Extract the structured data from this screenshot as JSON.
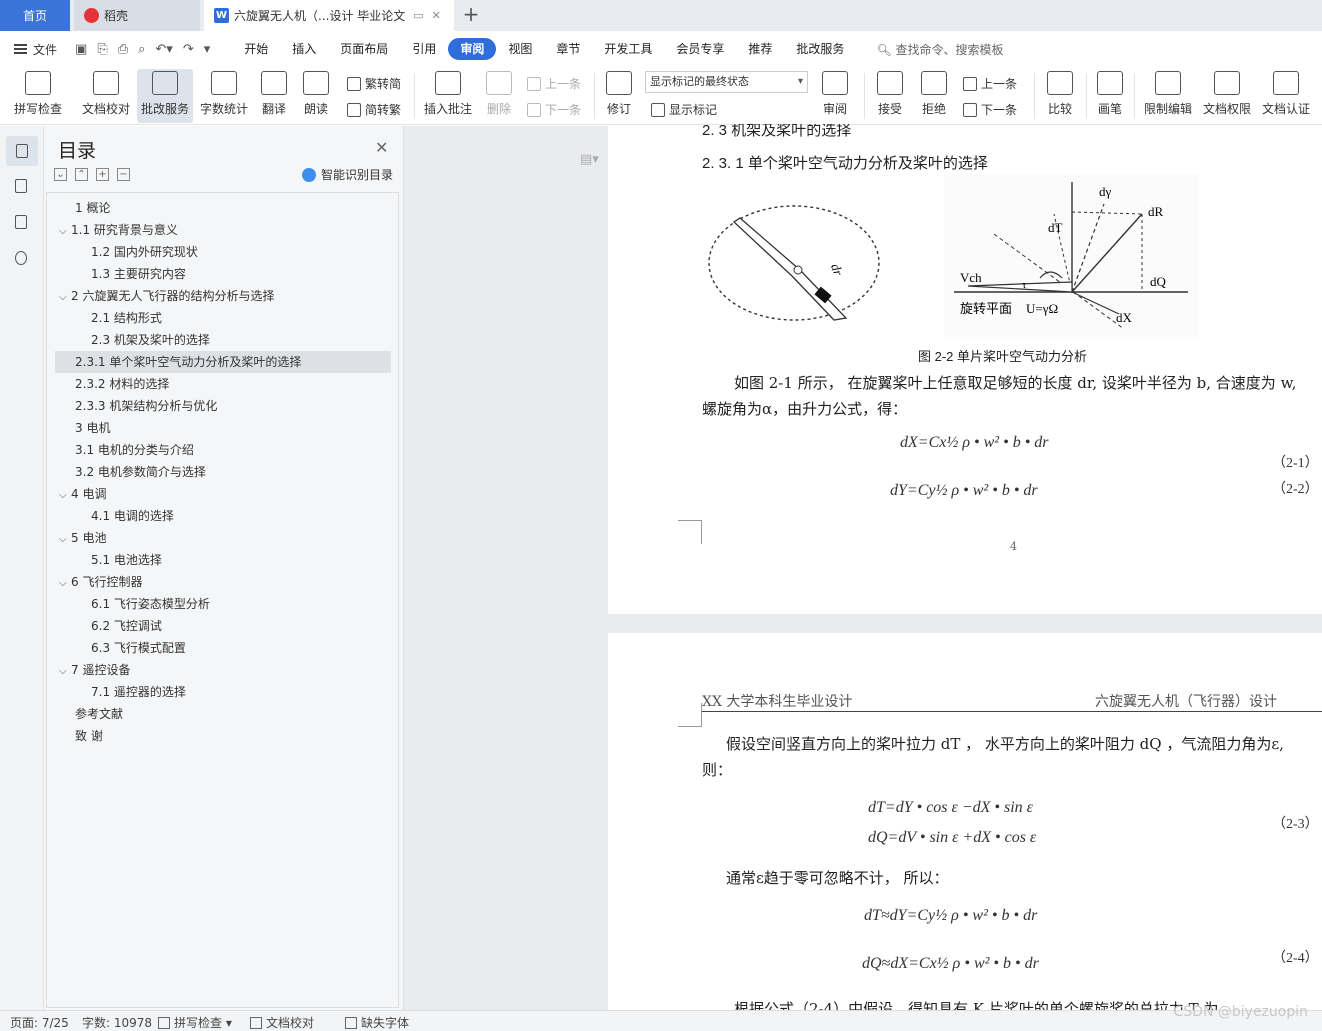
{
  "tabs": {
    "home": "首页",
    "daoke": "稻壳",
    "doc": "六旋翼无人机（...设计 毕业论文"
  },
  "menu": {
    "file": "文件",
    "tabs": [
      "开始",
      "插入",
      "页面布局",
      "引用",
      "审阅",
      "视图",
      "章节",
      "开发工具",
      "会员专享",
      "推荐",
      "批改服务"
    ],
    "active_tab": "审阅",
    "search": "查找命令、搜索模板"
  },
  "ribbon": {
    "spell": "拼写检查",
    "proof": "文档校对",
    "correct": "批改服务",
    "wordcount": "字数统计",
    "translate": "翻译",
    "read": "朗读",
    "to_trad": "繁转简",
    "to_simp": "简转繁",
    "insert_comment": "插入批注",
    "delete": "删除",
    "prev": "上一条",
    "next": "下一条",
    "revise": "修订",
    "markup_state": "显示标记的最终状态",
    "show_markup": "显示标记",
    "review": "审阅",
    "accept": "接受",
    "reject": "拒绝",
    "prev2": "上一条",
    "next2": "下一条",
    "compare": "比较",
    "pen": "画笔",
    "restrict": "限制编辑",
    "permission": "文档权限",
    "certify": "文档认证"
  },
  "toc": {
    "title": "目录",
    "ai": "智能识别目录",
    "items": [
      {
        "label": "1  概论",
        "level": 1,
        "chev": ""
      },
      {
        "label": "1.1  研究背景与意义",
        "level": 1,
        "chev": "v"
      },
      {
        "label": "1.2  国内外研究现状",
        "level": 2,
        "chev": ""
      },
      {
        "label": "1.3  主要研究内容",
        "level": 2,
        "chev": ""
      },
      {
        "label": "2 六旋翼无人飞行器的结构分析与选择",
        "level": 1,
        "chev": "v"
      },
      {
        "label": "2.1 结构形式",
        "level": 2,
        "chev": ""
      },
      {
        "label": "2.3 机架及桨叶的选择",
        "level": 2,
        "chev": ""
      },
      {
        "label": "2.3.1  单个桨叶空气动力分析及桨叶的选择",
        "level": 1,
        "chev": "",
        "selected": true
      },
      {
        "label": "2.3.2 材料的选择",
        "level": 1,
        "chev": ""
      },
      {
        "label": "2.3.3 机架结构分析与优化",
        "level": 1,
        "chev": ""
      },
      {
        "label": "3 电机",
        "level": 1,
        "chev": ""
      },
      {
        "label": "3.1 电机的分类与介绍",
        "level": 1,
        "chev": ""
      },
      {
        "label": "3.2 电机参数简介与选择",
        "level": 1,
        "chev": ""
      },
      {
        "label": "4 电调",
        "level": 1,
        "chev": "v"
      },
      {
        "label": "4.1 电调的选择",
        "level": 2,
        "chev": ""
      },
      {
        "label": "5 电池",
        "level": 1,
        "chev": "v"
      },
      {
        "label": "5.1 电池选择",
        "level": 2,
        "chev": ""
      },
      {
        "label": "6 飞行控制器",
        "level": 1,
        "chev": "v"
      },
      {
        "label": "6.1 飞行姿态模型分析",
        "level": 2,
        "chev": ""
      },
      {
        "label": "6.2 飞控调试",
        "level": 2,
        "chev": ""
      },
      {
        "label": "6.3 飞行模式配置",
        "level": 2,
        "chev": ""
      },
      {
        "label": "7 遥控设备",
        "level": 1,
        "chev": "v"
      },
      {
        "label": "7.1 遥控器的选择",
        "level": 2,
        "chev": ""
      },
      {
        "label": "参考文献",
        "level": 1,
        "chev": ""
      },
      {
        "label": "致    谢",
        "level": 1,
        "chev": ""
      }
    ]
  },
  "page1": {
    "partial_heading": "2. 3 机架及桨叶的选择",
    "heading": "2. 3. 1  单个桨叶空气动力分析及桨叶的选择",
    "fig_labels": {
      "dgamma": "dγ",
      "dT": "dT",
      "dR": "dR",
      "Vch": "Vch",
      "tau": "τ",
      "dQ": "dQ",
      "plane": "旋转平面",
      "U": "U=γΩ",
      "dX": "dX",
      "dr": "dr"
    },
    "caption": "图 2-2    单片桨叶空气动力分析",
    "para1": "如图 2-1 所示，  在旋翼桨叶上任意取足够短的长度 dr, 设桨叶半径为   b, 合速度为 w,",
    "para2": "螺旋角为α，由升力公式，得：",
    "eq1": "dX=Cx½ ρ  • w² • b • dr",
    "eq1_no": "（2-1）",
    "eq2": "dY=Cy½ ρ  • w² • b • dr",
    "eq2_no": "（2-2）",
    "page_num": "4"
  },
  "page2": {
    "header_left": "XX 大学本科生毕业设计",
    "header_right": "六旋翼无人机（飞行器）设计",
    "para1": "假设空间竖直方向上的桨叶拉力 dT ，   水平方向上的桨叶阻力   dQ ，气流阻力角为ε,",
    "para1b": "则：",
    "eq3a": "dT=dY • cos ε −dX • sin ε",
    "eq3b": "dQ=dV • sin ε +dX • cos ε",
    "eq3_no": "（2-3）",
    "para2": "通常ε趋于零可忽略不计，  所以：",
    "eq4a": "dT≈dY=Cy½ ρ  • w² • b • dr",
    "eq4b": "dQ≈dX=Cx½ ρ  • w² • b • dr",
    "eq4_no": "（2-4）",
    "para3": "根据公式（2-4）中假设，得知具有   K  片桨叶的单个螺旋桨的总拉力  T 为"
  },
  "status": {
    "page": "页面: 7/25",
    "words": "字数: 10978",
    "spell": "拼写检查",
    "proof": "文档校对",
    "font": "缺失字体"
  },
  "watermark": "CSDN @biyezuopin"
}
